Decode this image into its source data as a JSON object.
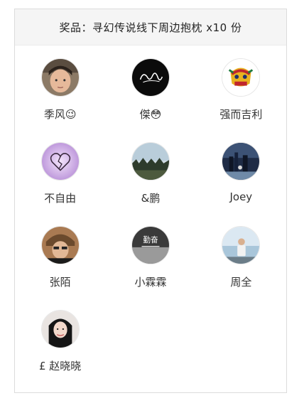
{
  "header": {
    "title": "奖品：寻幻传说线下周边抱枕 x10 份"
  },
  "winners": [
    {
      "name": "季风😉",
      "avatar_icon": "child-photo-avatar"
    },
    {
      "name": "傑😳",
      "avatar_icon": "signature-black-avatar"
    },
    {
      "name": "强而吉利",
      "avatar_icon": "lion-dance-avatar"
    },
    {
      "name": "不自由",
      "avatar_icon": "broken-heart-purple-avatar"
    },
    {
      "name": "&鹏",
      "avatar_icon": "forest-landscape-avatar"
    },
    {
      "name": "Joey",
      "avatar_icon": "night-city-avatar"
    },
    {
      "name": "张陌",
      "avatar_icon": "man-fur-hat-avatar"
    },
    {
      "name": "小霖霖",
      "avatar_icon": "bw-text-poster-avatar"
    },
    {
      "name": "周全",
      "avatar_icon": "man-seaside-avatar"
    },
    {
      "name": "£ 赵晓晓",
      "avatar_icon": "woman-portrait-avatar"
    }
  ],
  "avatar_text": {
    "poster": "勤奋"
  }
}
